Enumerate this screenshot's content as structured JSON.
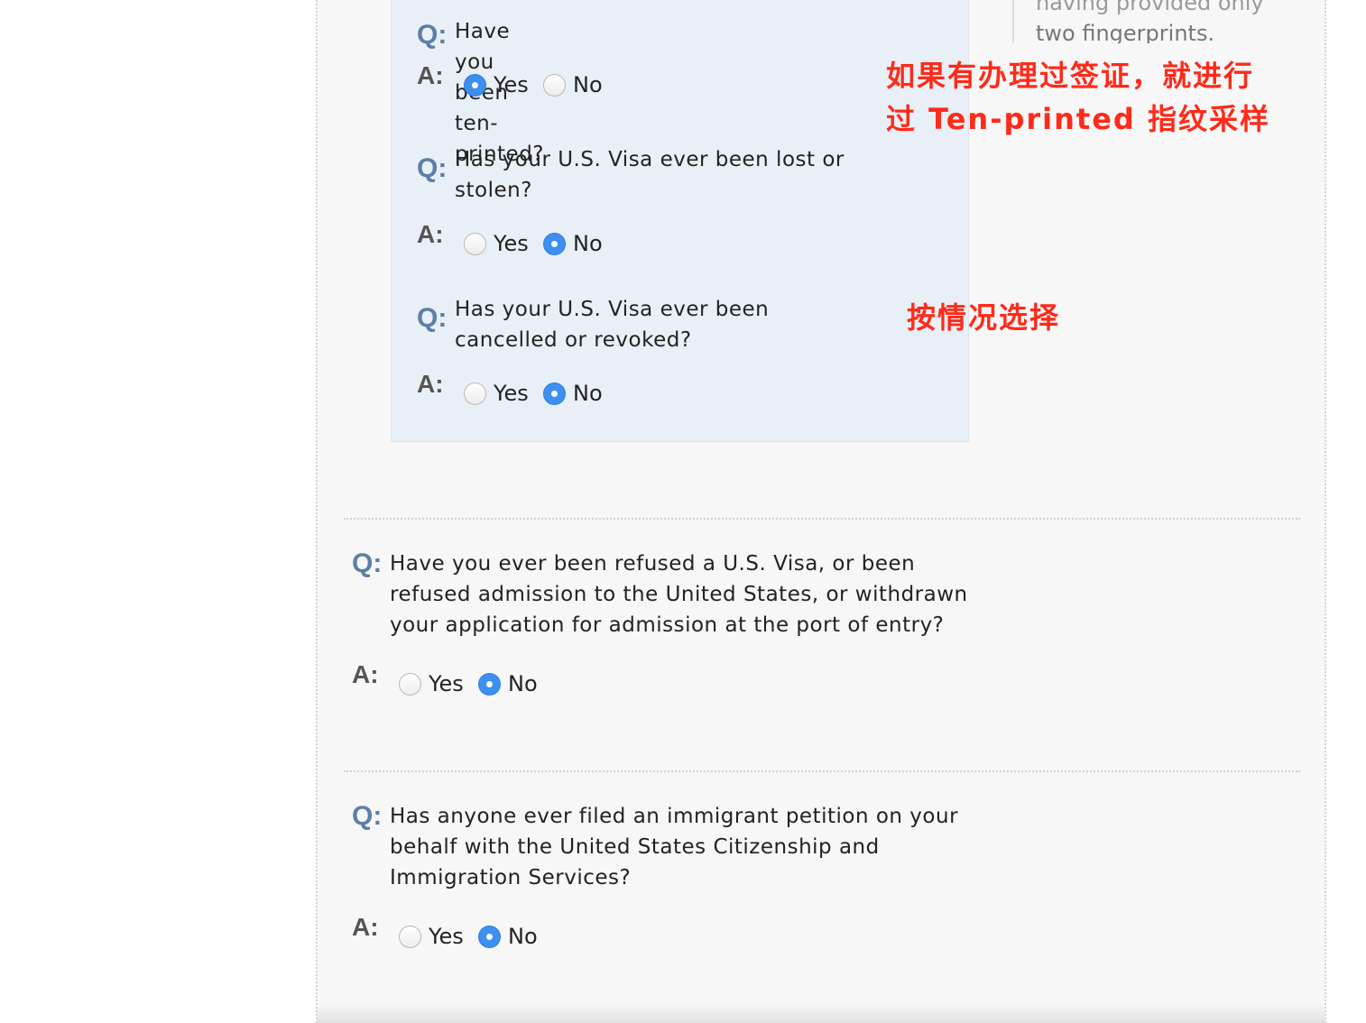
{
  "side_note": {
    "line1": "having provided only",
    "line2": "two fingerprints."
  },
  "labels": {
    "q": "Q:",
    "a": "A:"
  },
  "questions": [
    {
      "text": "Have you been ten-printed?",
      "yes": "Yes",
      "no": "No",
      "selected": "yes"
    },
    {
      "text": "Has your U.S. Visa ever been lost or stolen?",
      "yes": "Yes",
      "no": "No",
      "selected": "no"
    },
    {
      "text": "Has your U.S. Visa ever been cancelled or revoked?",
      "yes": "Yes",
      "no": "No",
      "selected": "no"
    },
    {
      "text": "Have you ever been refused a U.S. Visa, or been refused admission to the United States, or withdrawn your application for admission at the port of entry?",
      "yes": "Yes",
      "no": "No",
      "selected": "no"
    },
    {
      "text": "Has anyone ever filed an immigrant petition on your behalf with the United States Citizenship and Immigration Services?",
      "yes": "Yes",
      "no": "No",
      "selected": "no"
    }
  ],
  "annotations": {
    "note1_line1": "如果有办理过签证，就进行",
    "note1_line2": "过 Ten-printed 指纹采样",
    "note2": "按情况选择"
  },
  "colors": {
    "annotation": "#ff2a1a",
    "q_label": "#5b7fa8",
    "radio_selected": "#3d8ff0",
    "subpanel_bg": "#e9eff6",
    "panel_bg": "#f7f7f7"
  }
}
